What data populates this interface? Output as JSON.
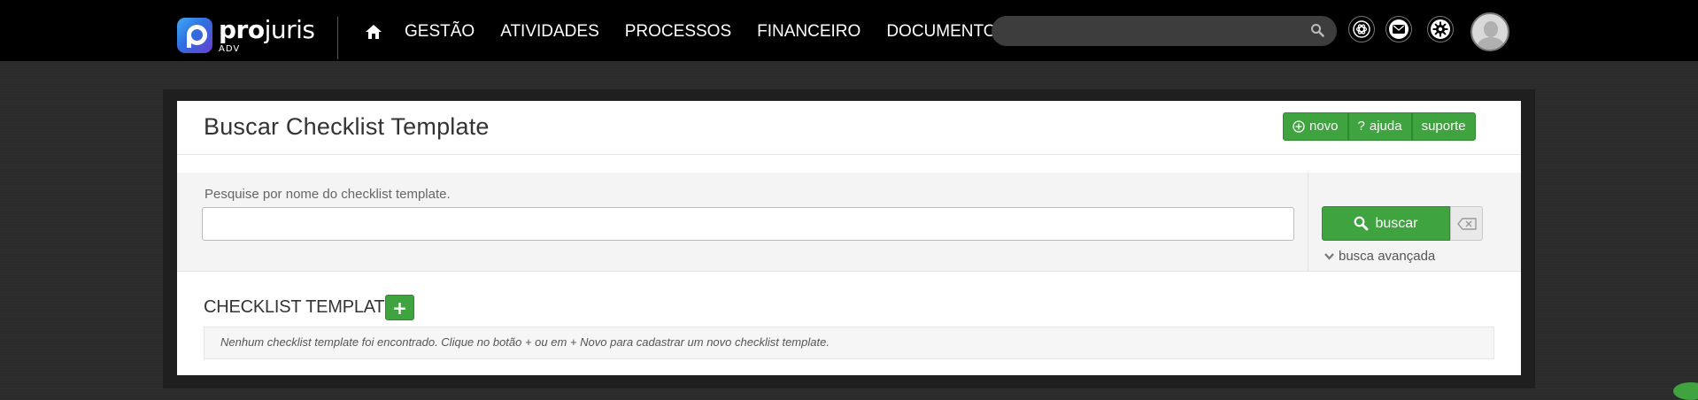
{
  "header": {
    "logo": {
      "name_bold": "pro",
      "name_light": "juris",
      "sub": "ADV"
    },
    "nav": [
      {
        "label": "GESTÃO"
      },
      {
        "label": "ATIVIDADES"
      },
      {
        "label": "PROCESSOS"
      },
      {
        "label": "FINANCEIRO"
      },
      {
        "label": "DOCUMENTOS"
      }
    ],
    "search": {
      "placeholder": "",
      "value": ""
    },
    "icons": [
      "home-icon",
      "search-icon",
      "openai-icon",
      "mail-icon",
      "gear-icon",
      "avatar"
    ]
  },
  "page": {
    "title": "Buscar Checklist Template",
    "actions": {
      "novo": "novo",
      "ajuda": "ajuda",
      "suporte": "suporte"
    },
    "search": {
      "label": "Pesquise por nome do checklist template.",
      "value": "",
      "buscar": "buscar",
      "advanced": "busca avançada"
    },
    "section": {
      "title": "CHECKLIST TEMPLATE",
      "empty_message": "Nenhum checklist template foi encontrado. Clique no botão + ou em + Novo para cadastrar um novo checklist template."
    }
  },
  "colors": {
    "topbar": "#000000",
    "background": "#2b2b2b",
    "accent_green": "#3fa33f",
    "card": "#ffffff"
  }
}
